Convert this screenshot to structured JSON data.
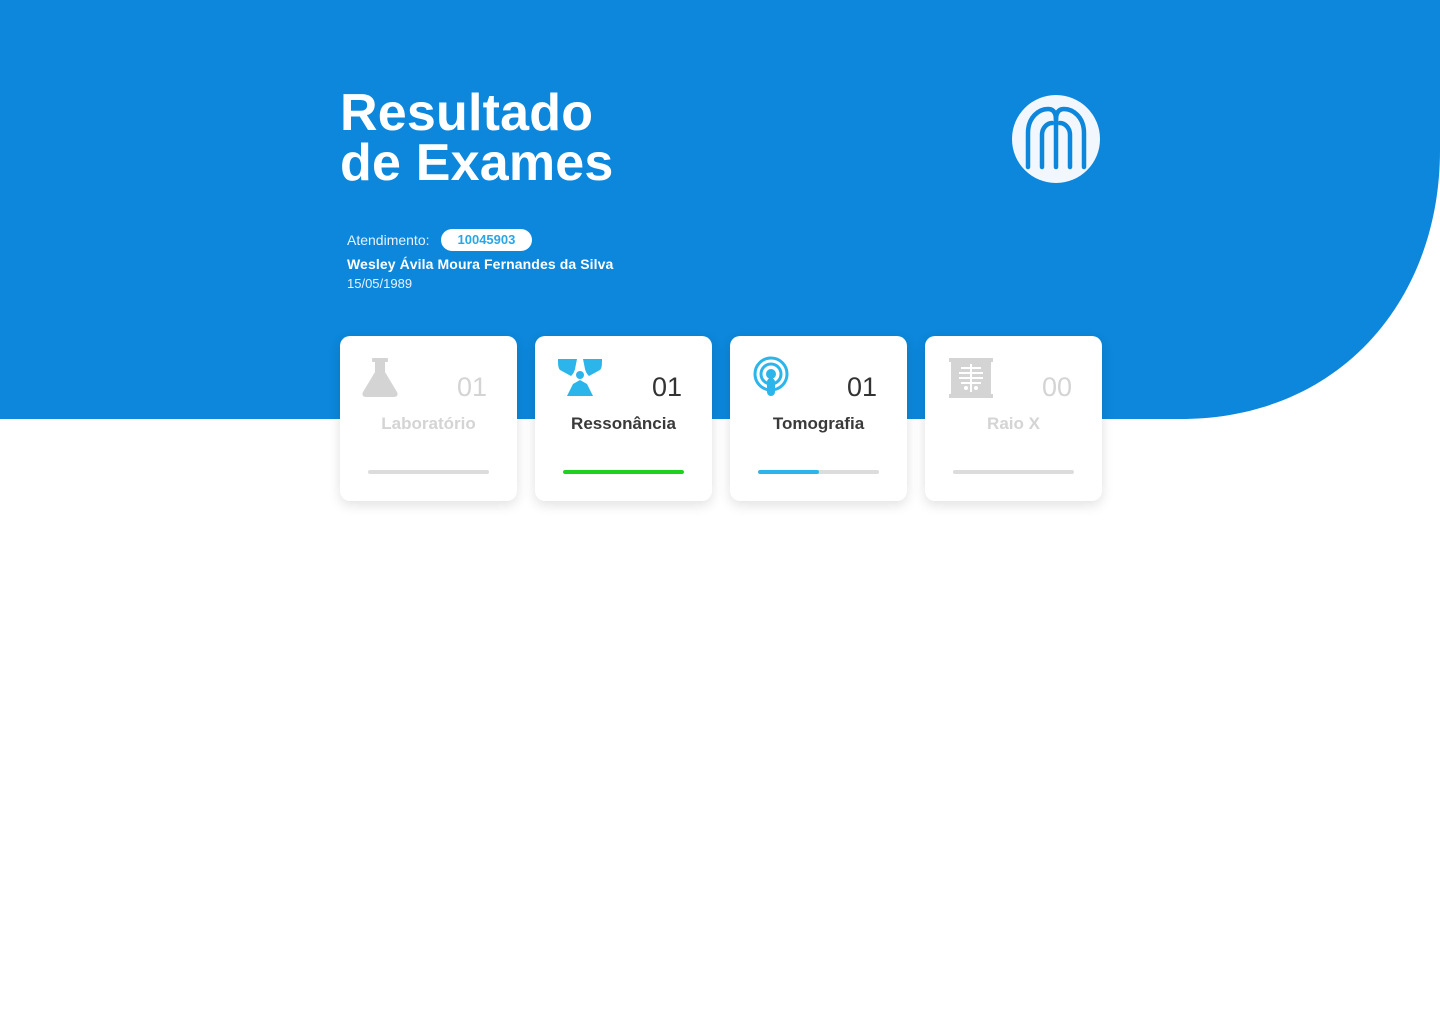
{
  "header": {
    "title_line1": "Resultado",
    "title_line2": "de Exames",
    "logo_icon": "hospital-logo-icon"
  },
  "colors": {
    "primary": "#0c87db",
    "accent": "#2aa6e6",
    "success": "#1fd11f",
    "disabled": "#d4d4d4",
    "text_dark": "#3a3a3a"
  },
  "patient": {
    "atendimento_label": "Atendimento:",
    "atendimento_number": "10045903",
    "name": "Wesley Ávila Moura Fernandes da Silva",
    "birth_date": "15/05/1989"
  },
  "exams": [
    {
      "label": "Laboratório",
      "count": "01",
      "icon": "flask-icon",
      "enabled": false,
      "progress": 0,
      "progress_color": "#dcdcdc"
    },
    {
      "label": "Ressonância",
      "count": "01",
      "icon": "radiation-icon",
      "enabled": true,
      "progress": 1.0,
      "progress_color": "#1fd11f"
    },
    {
      "label": "Tomografia",
      "count": "01",
      "icon": "scanner-icon",
      "enabled": true,
      "progress": 0.5,
      "progress_color": "#2bb5ea"
    },
    {
      "label": "Raio X",
      "count": "00",
      "icon": "xray-icon",
      "enabled": false,
      "progress": 0,
      "progress_color": "#dcdcdc"
    }
  ]
}
